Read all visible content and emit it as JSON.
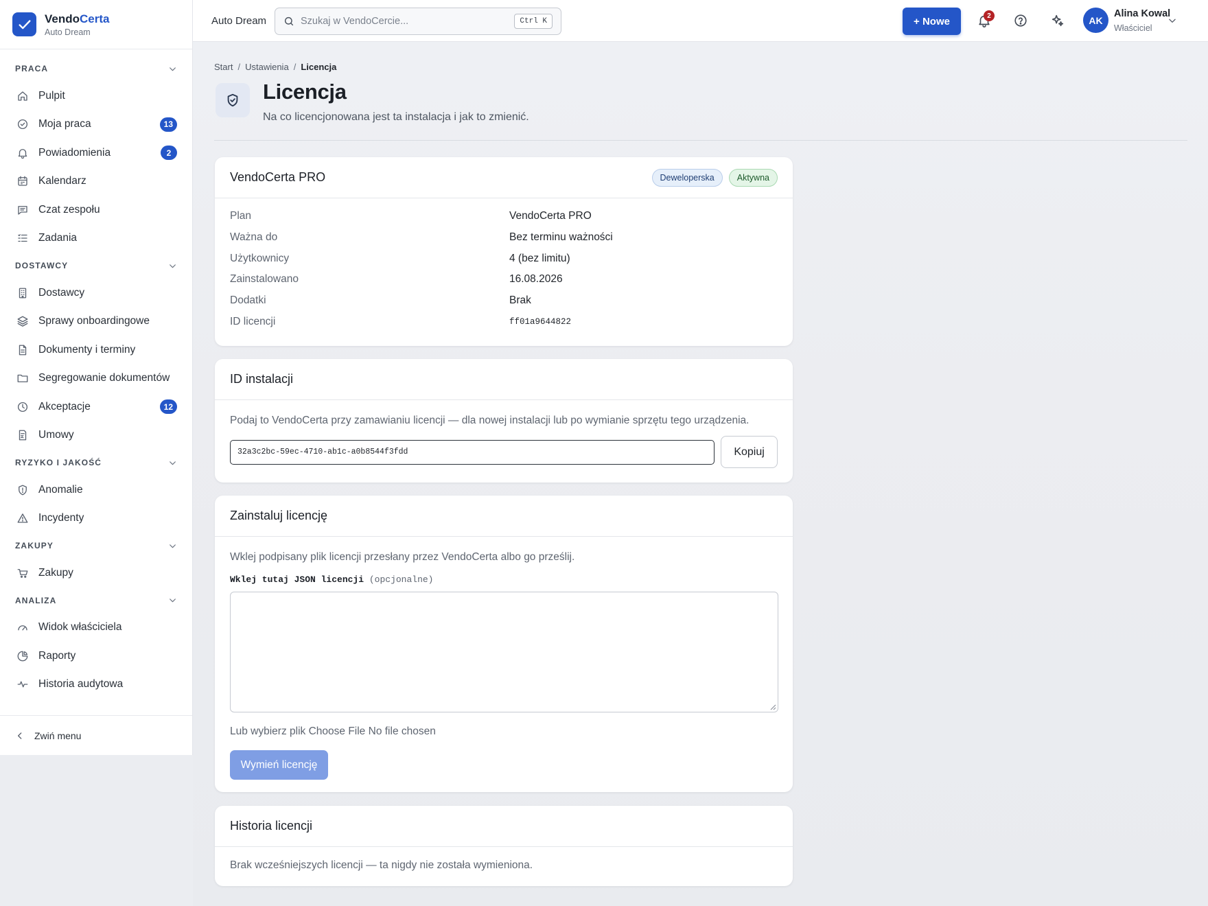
{
  "brand": {
    "name_a": "Vendo",
    "name_b": "Certa",
    "workspace": "Auto Dream"
  },
  "sidebar": {
    "sections": [
      {
        "title": "PRACA",
        "items": [
          {
            "label": "Pulpit",
            "icon": "home-icon"
          },
          {
            "label": "Moja praca",
            "icon": "check-circle-icon",
            "badge": "13"
          },
          {
            "label": "Powiadomienia",
            "icon": "bell-icon",
            "badge": "2"
          },
          {
            "label": "Kalendarz",
            "icon": "calendar-icon"
          },
          {
            "label": "Czat zespołu",
            "icon": "chat-icon"
          },
          {
            "label": "Zadania",
            "icon": "list-check-icon"
          }
        ]
      },
      {
        "title": "DOSTAWCY",
        "items": [
          {
            "label": "Dostawcy",
            "icon": "building-icon"
          },
          {
            "label": "Sprawy onboardingowe",
            "icon": "layers-icon"
          },
          {
            "label": "Dokumenty i terminy",
            "icon": "document-icon"
          },
          {
            "label": "Segregowanie dokumentów",
            "icon": "folder-icon"
          },
          {
            "label": "Akceptacje",
            "icon": "clock-icon",
            "badge": "12"
          },
          {
            "label": "Umowy",
            "icon": "contract-icon"
          }
        ]
      },
      {
        "title": "RYZYKO I JAKOŚĆ",
        "items": [
          {
            "label": "Anomalie",
            "icon": "shield-icon"
          },
          {
            "label": "Incydenty",
            "icon": "warning-icon"
          }
        ]
      },
      {
        "title": "ZAKUPY",
        "items": [
          {
            "label": "Zakupy",
            "icon": "cart-icon"
          }
        ]
      },
      {
        "title": "ANALIZA",
        "items": [
          {
            "label": "Widok właściciela",
            "icon": "gauge-icon"
          },
          {
            "label": "Raporty",
            "icon": "pie-chart-icon"
          },
          {
            "label": "Historia audytowa",
            "icon": "activity-icon"
          }
        ]
      }
    ],
    "collapse_label": "Zwiń menu"
  },
  "topbar": {
    "workspace": "Auto Dream",
    "search_placeholder": "Szukaj w VendoCercie...",
    "search_shortcut": "Ctrl K",
    "new_button": "+ Nowe",
    "notifications_count": "2",
    "user_initials": "AK",
    "user_name": "Alina Kowal",
    "user_role": "Właściciel"
  },
  "page": {
    "breadcrumb": [
      "Start",
      "Ustawienia",
      "Licencja"
    ],
    "title": "Licencja",
    "subtitle": "Na co licencjonowana jest ta instalacja i jak to zmienić."
  },
  "license_card": {
    "title": "VendoCerta PRO",
    "badge_type": "Deweloperska",
    "badge_status": "Aktywna",
    "rows": [
      {
        "key": "Plan",
        "value": "VendoCerta PRO"
      },
      {
        "key": "Ważna do",
        "value": "Bez terminu ważności"
      },
      {
        "key": "Użytkownicy",
        "value": "4 (bez limitu)"
      },
      {
        "key": "Zainstalowano",
        "value": "16.08.2026"
      },
      {
        "key": "Dodatki",
        "value": "Brak"
      },
      {
        "key": "ID licencji",
        "value": "ff01a9644822"
      }
    ]
  },
  "install_card": {
    "title": "ID instalacji",
    "description": "Podaj to VendoCerta przy zamawianiu licencji — dla nowej instalacji lub po wymianie sprzętu tego urządzenia.",
    "install_id": "32a3c2bc-59ec-4710-ab1c-a0b8544f3fdd",
    "copy_button": "Kopiuj"
  },
  "upload_card": {
    "title": "Zainstaluj licencję",
    "description": "Wklej podpisany plik licencji przesłany przez VendoCerta albo go prześlij.",
    "json_label": "Wklej tutaj JSON licencji",
    "json_optional": "(opcjonalne)",
    "json_value": "",
    "file_label": "Lub wybierz plik",
    "file_button": "Choose File",
    "file_status": "No file chosen",
    "submit_button": "Wymień licencję"
  },
  "history_card": {
    "title": "Historia licencji",
    "empty_text": "Brak wcześniejszych licencji — ta nigdy nie została wymieniona."
  },
  "colors": {
    "accent": "#2456c8",
    "badge_red": "#b42326",
    "disabled_button": "#7f9ee4"
  }
}
